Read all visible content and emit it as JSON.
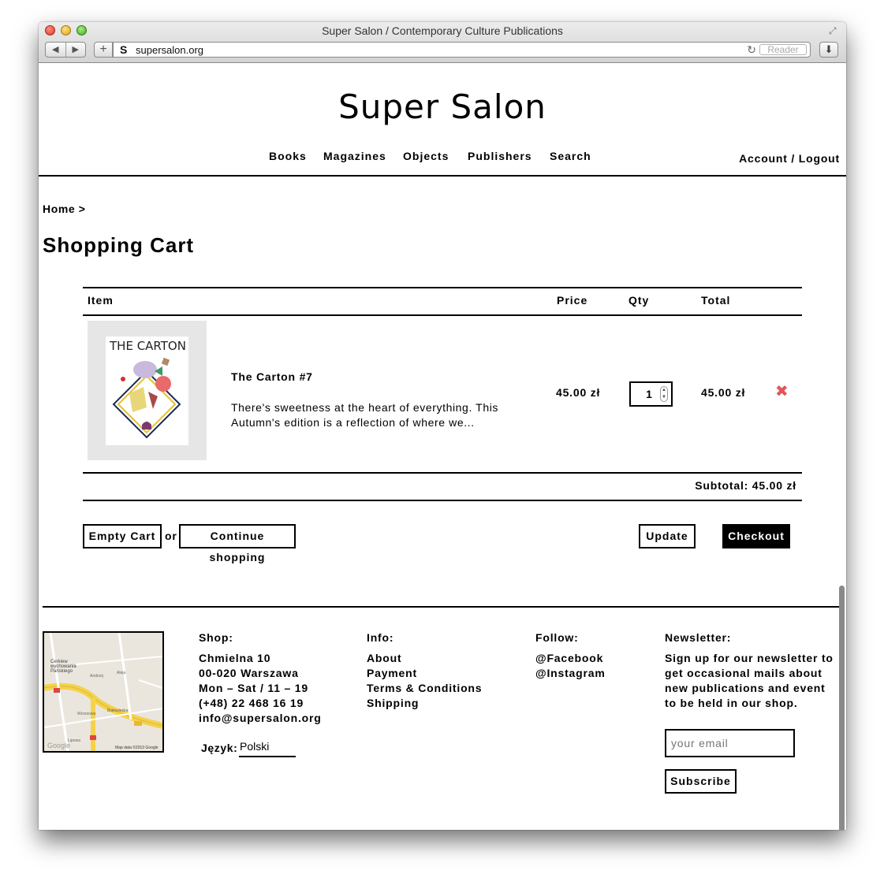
{
  "browser": {
    "window_title": "Super Salon / Contemporary Culture Publications",
    "url": "supersalon.org",
    "reader_label": "Reader",
    "favicon": "S"
  },
  "site": {
    "logo": "Super Salon",
    "nav": [
      "Books",
      "Magazines",
      "Objects",
      "Publishers",
      "Search"
    ],
    "account": "Account / Logout"
  },
  "breadcrumb": "Home >",
  "page_title": "Shopping Cart",
  "cart": {
    "columns": {
      "item": "Item",
      "price": "Price",
      "qty": "Qty",
      "total": "Total"
    },
    "items": [
      {
        "cover_text": "THE CARTON",
        "title": "The Carton #7",
        "description": "There's sweetness at the heart of everything. This Autumn's edition is a reflection of where we...",
        "price": "45.00 zł",
        "qty": "1",
        "total": "45.00 zł"
      }
    ],
    "subtotal": "Subtotal: 45.00 zł",
    "buttons": {
      "empty": "Empty Cart",
      "or": "or",
      "continue": "Continue shopping",
      "update": "Update",
      "checkout": "Checkout"
    }
  },
  "footer": {
    "shop": {
      "heading": "Shop:",
      "lines": [
        "Chmielna 10",
        "00-020 Warszawa",
        "Mon – Sat / 11 – 19",
        "(+48) 22 468 16 19",
        "info@supersalon.org"
      ]
    },
    "language": {
      "label": "Język:",
      "value": "Polski"
    },
    "info": {
      "heading": "Info:",
      "links": [
        "About",
        "Payment",
        "Terms & Conditions",
        "Shipping"
      ]
    },
    "follow": {
      "heading": "Follow:",
      "links": [
        "@Facebook",
        "@Instagram"
      ]
    },
    "newsletter": {
      "heading": "Newsletter:",
      "text": "Sign up for our newsletter to get occasional mails about new publications and event to be held in our shop.",
      "placeholder": "your email",
      "button": "Subscribe"
    },
    "map": {
      "labels": [
        "Cerkiew",
        "wychowania",
        "Pańskiego",
        "Andrzej",
        "Aleja",
        "Białowieska",
        "Wrzosowa",
        "Lipowa",
        "Map data ©2013 Google",
        "Google"
      ]
    }
  },
  "colors": {
    "remove": "#e2555a",
    "checkout_bg": "#000000"
  }
}
